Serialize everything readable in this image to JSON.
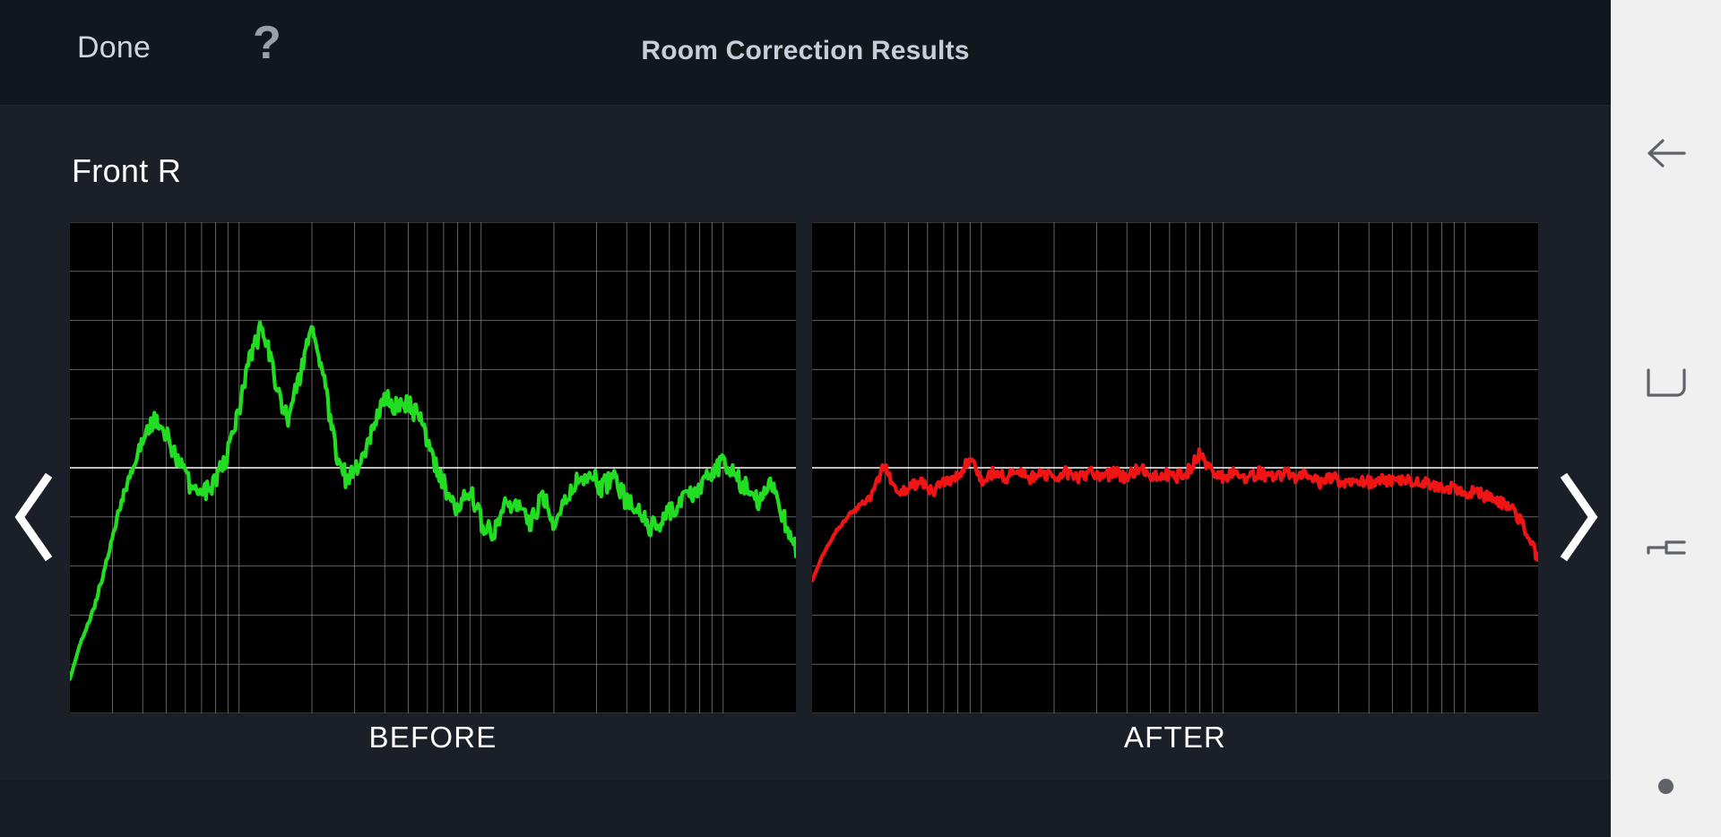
{
  "header": {
    "done_label": "Done",
    "help_icon": "question-mark-icon",
    "title": "Room Correction Results"
  },
  "main": {
    "channel_label": "Front R",
    "prev_icon": "chevron-left-icon",
    "next_icon": "chevron-right-icon"
  },
  "colors": {
    "before_trace": "#22dd22",
    "after_trace": "#f01414",
    "plot_background": "#000000",
    "grid_line": "#8a8a8a",
    "zero_line": "#ffffff",
    "app_background": "#1b1f28",
    "topbar_background": "#12161d",
    "navbar_background": "#f0f0f0"
  },
  "navbar": {
    "items": [
      {
        "name": "back-arrow-icon",
        "label": "Back"
      },
      {
        "name": "square-overview-icon",
        "label": "Home"
      },
      {
        "name": "recents-icon",
        "label": "Recents"
      },
      {
        "name": "dot-indicator-icon",
        "label": "Assistant"
      }
    ]
  },
  "chart_data": [
    {
      "type": "line",
      "title": "BEFORE",
      "series_name": "Front R before correction",
      "color": "#22dd22",
      "xlabel": "",
      "ylabel": "",
      "xscale": "log",
      "xlim": [
        20,
        20000
      ],
      "ylim": [
        -25,
        25
      ],
      "zero_line_db": 0,
      "grid": true,
      "ygrid_step_db": 5,
      "xgrid_decades": [
        20,
        30,
        40,
        50,
        60,
        70,
        80,
        90,
        100,
        200,
        300,
        400,
        500,
        600,
        700,
        800,
        900,
        1000,
        2000,
        3000,
        4000,
        5000,
        6000,
        7000,
        8000,
        9000,
        10000,
        20000
      ],
      "x": [
        20,
        22,
        25,
        28,
        31,
        35,
        40,
        45,
        50,
        56,
        63,
        71,
        80,
        90,
        100,
        112,
        125,
        140,
        160,
        180,
        200,
        224,
        250,
        280,
        315,
        355,
        400,
        450,
        500,
        560,
        630,
        710,
        800,
        900,
        1000,
        1120,
        1250,
        1400,
        1600,
        1800,
        2000,
        2240,
        2500,
        2800,
        3150,
        3550,
        4000,
        4500,
        5000,
        5600,
        6300,
        7100,
        8000,
        9000,
        10000,
        11200,
        12500,
        14000,
        16000,
        18000,
        20000
      ],
      "values": [
        -21.5,
        -18.0,
        -14.5,
        -10.0,
        -5.5,
        -1.0,
        3.0,
        5.0,
        3.5,
        0.5,
        -2.0,
        -2.5,
        -1.5,
        1.5,
        6.0,
        11.5,
        14.5,
        9.0,
        4.5,
        10.0,
        14.0,
        9.0,
        2.0,
        -1.5,
        0.5,
        4.0,
        7.5,
        6.0,
        6.5,
        5.0,
        1.0,
        -2.0,
        -4.0,
        -2.0,
        -5.5,
        -6.5,
        -4.0,
        -3.5,
        -6.0,
        -2.5,
        -5.5,
        -3.0,
        -1.5,
        -0.5,
        -2.0,
        -1.0,
        -3.5,
        -4.5,
        -6.0,
        -5.5,
        -4.0,
        -3.0,
        -2.0,
        -0.5,
        0.5,
        -1.0,
        -2.0,
        -3.5,
        -1.5,
        -5.5,
        -8.0
      ]
    },
    {
      "type": "line",
      "title": "AFTER",
      "series_name": "Front R after correction",
      "color": "#f01414",
      "xlabel": "",
      "ylabel": "",
      "xscale": "log",
      "xlim": [
        20,
        20000
      ],
      "ylim": [
        -25,
        25
      ],
      "zero_line_db": 0,
      "grid": true,
      "ygrid_step_db": 5,
      "xgrid_decades": [
        20,
        30,
        40,
        50,
        60,
        70,
        80,
        90,
        100,
        200,
        300,
        400,
        500,
        600,
        700,
        800,
        900,
        1000,
        2000,
        3000,
        4000,
        5000,
        6000,
        7000,
        8000,
        9000,
        10000,
        20000
      ],
      "x": [
        20,
        22,
        25,
        28,
        31,
        35,
        40,
        45,
        50,
        56,
        63,
        71,
        80,
        90,
        100,
        112,
        125,
        140,
        160,
        180,
        200,
        224,
        250,
        280,
        315,
        355,
        400,
        450,
        500,
        560,
        630,
        710,
        800,
        900,
        1000,
        1120,
        1250,
        1400,
        1600,
        1800,
        2000,
        2240,
        2500,
        2800,
        3150,
        3550,
        4000,
        4500,
        5000,
        5600,
        6300,
        7100,
        8000,
        9000,
        10000,
        11200,
        12500,
        14000,
        16000,
        18000,
        20000
      ],
      "values": [
        -11.5,
        -9.0,
        -6.5,
        -5.0,
        -4.0,
        -3.0,
        0.5,
        -3.0,
        -2.0,
        -1.5,
        -2.5,
        -1.5,
        -1.0,
        1.0,
        -1.5,
        -0.5,
        -1.0,
        -0.5,
        -1.0,
        -0.5,
        -1.0,
        -0.5,
        -1.0,
        -0.5,
        -1.0,
        -0.5,
        -1.0,
        0.0,
        -1.0,
        -0.5,
        -1.0,
        -0.5,
        1.5,
        -0.5,
        -1.0,
        -0.5,
        -1.0,
        -0.5,
        -1.0,
        -0.5,
        -1.0,
        -0.5,
        -1.5,
        -1.0,
        -1.5,
        -1.0,
        -1.5,
        -1.0,
        -1.5,
        -1.0,
        -1.5,
        -1.5,
        -2.0,
        -2.0,
        -2.5,
        -2.5,
        -3.0,
        -3.5,
        -4.5,
        -6.5,
        -9.5
      ]
    }
  ]
}
